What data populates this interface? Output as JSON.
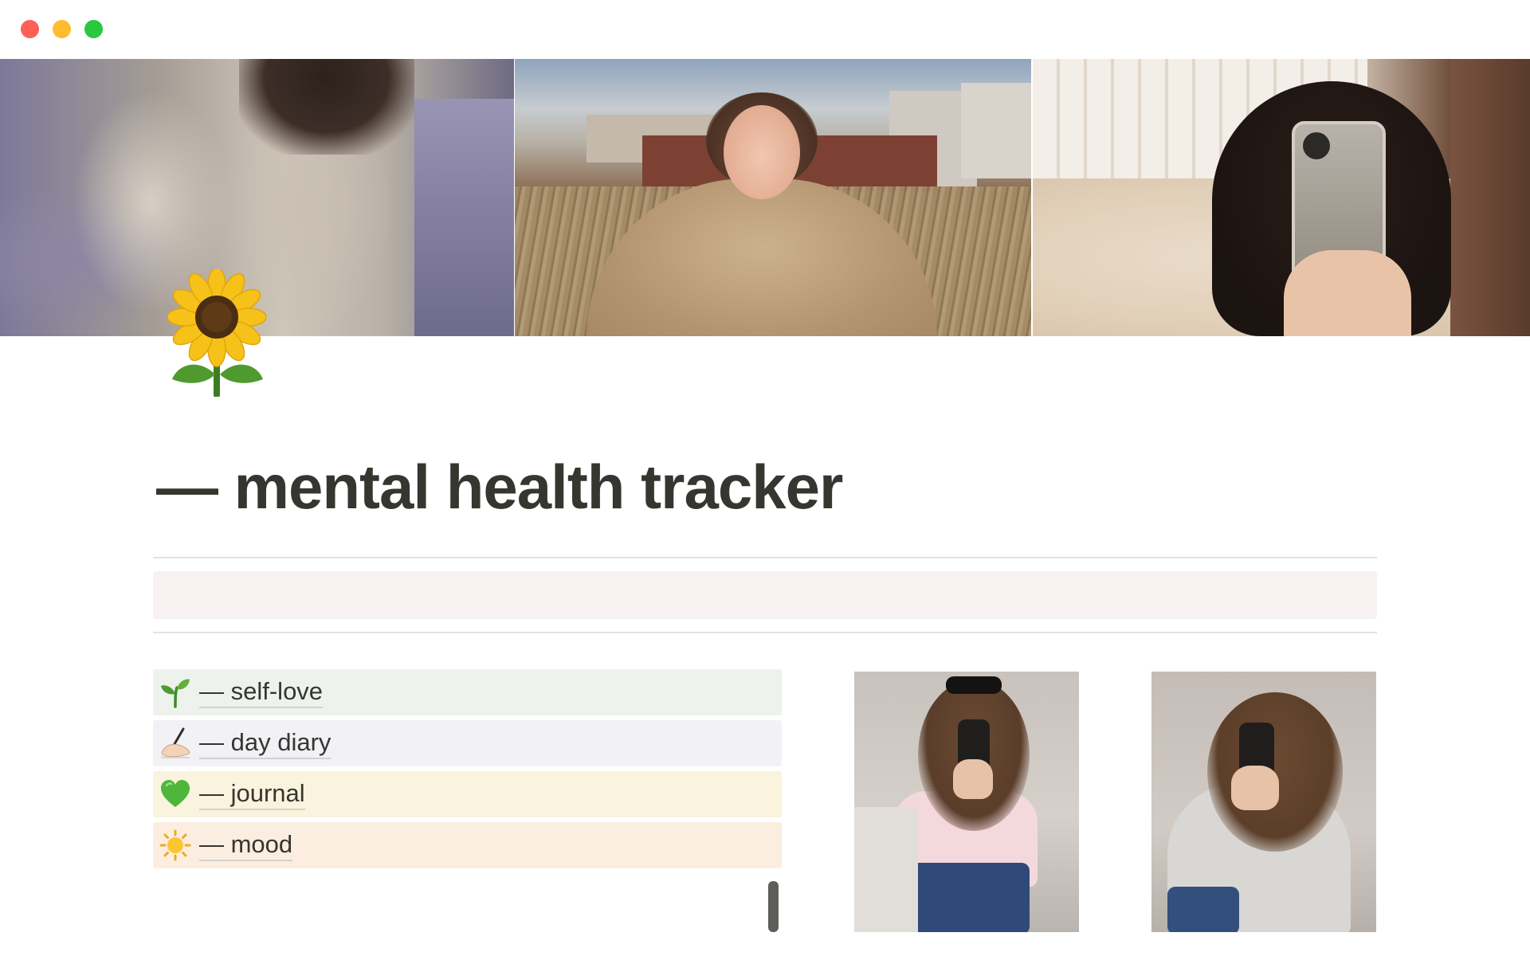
{
  "window": {
    "controls": [
      "close",
      "minimize",
      "zoom"
    ]
  },
  "page": {
    "icon": "sunflower-icon",
    "title": "— mental health tracker"
  },
  "links": [
    {
      "emoji": "seedling-icon",
      "label": "— self-love",
      "bg": "#edf3ec"
    },
    {
      "emoji": "writing-hand-icon",
      "label": "— day diary",
      "bg": "#f1f1f6"
    },
    {
      "emoji": "green-heart-icon",
      "label": "— journal",
      "bg": "#faf3dd"
    },
    {
      "emoji": "sun-icon",
      "label": "— mood",
      "bg": "#fbeee0"
    }
  ],
  "colors": {
    "callout_bg": "#f7f1f2",
    "text": "#37352f",
    "divider": "#e3e2e0"
  }
}
